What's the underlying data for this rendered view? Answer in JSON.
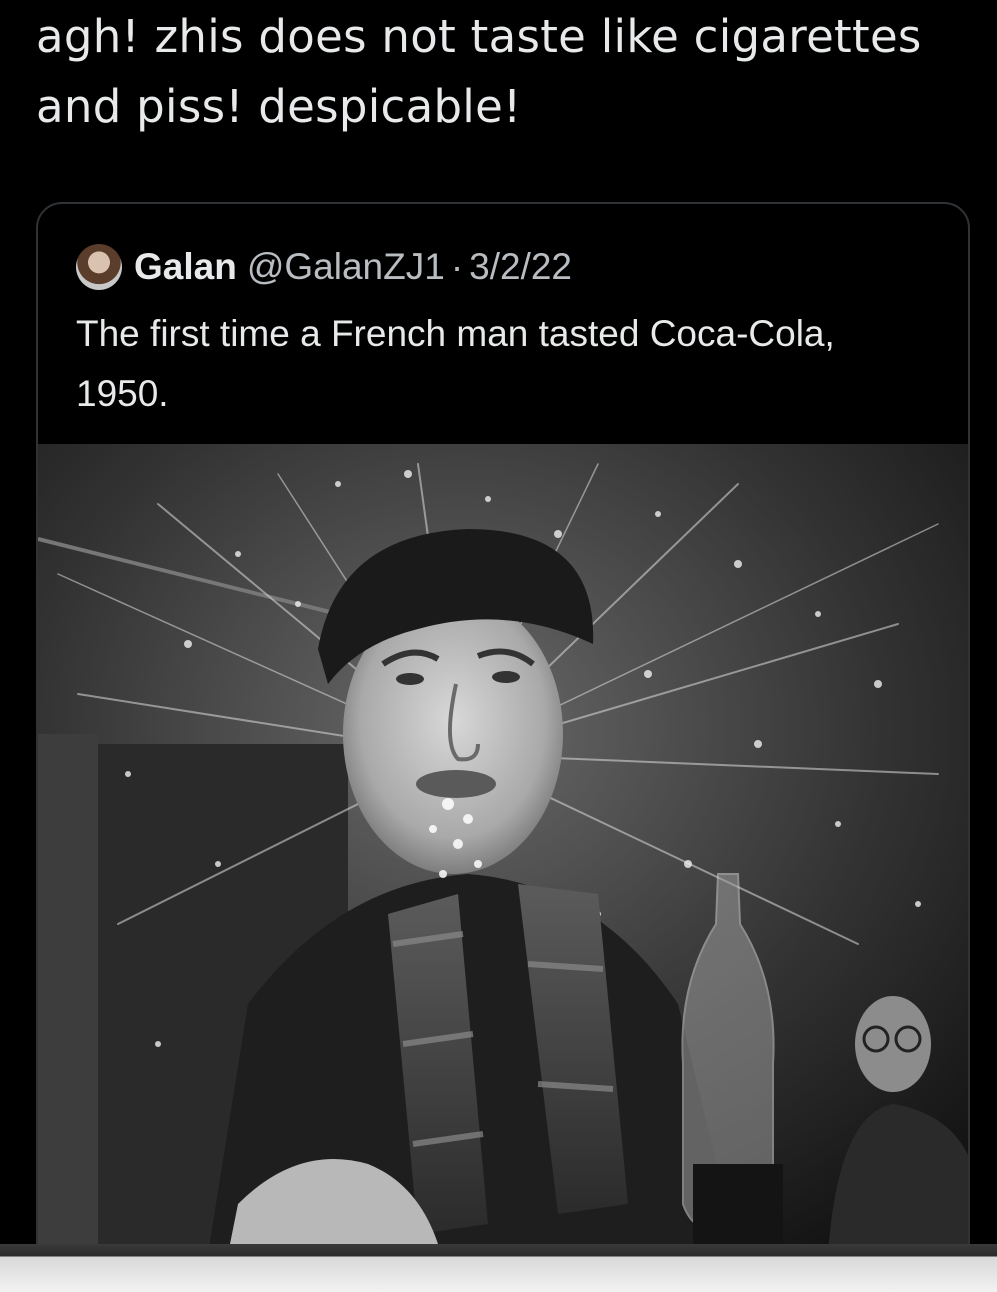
{
  "tweet": {
    "text": "agh! zhis does not taste like cigarettes and piss! despicable!"
  },
  "quoted_tweet": {
    "display_name": "Galan",
    "handle": "@GalanZJ1",
    "separator": "·",
    "date": "3/2/22",
    "text": "The first time a French man tasted Coca-Cola, 1950."
  },
  "icons": {
    "avatar": "user-avatar-photo"
  },
  "colors": {
    "background": "#000000",
    "text": "#e7e9ea",
    "secondary_text": "#b9bdc1",
    "card_border": "#2f3336"
  }
}
